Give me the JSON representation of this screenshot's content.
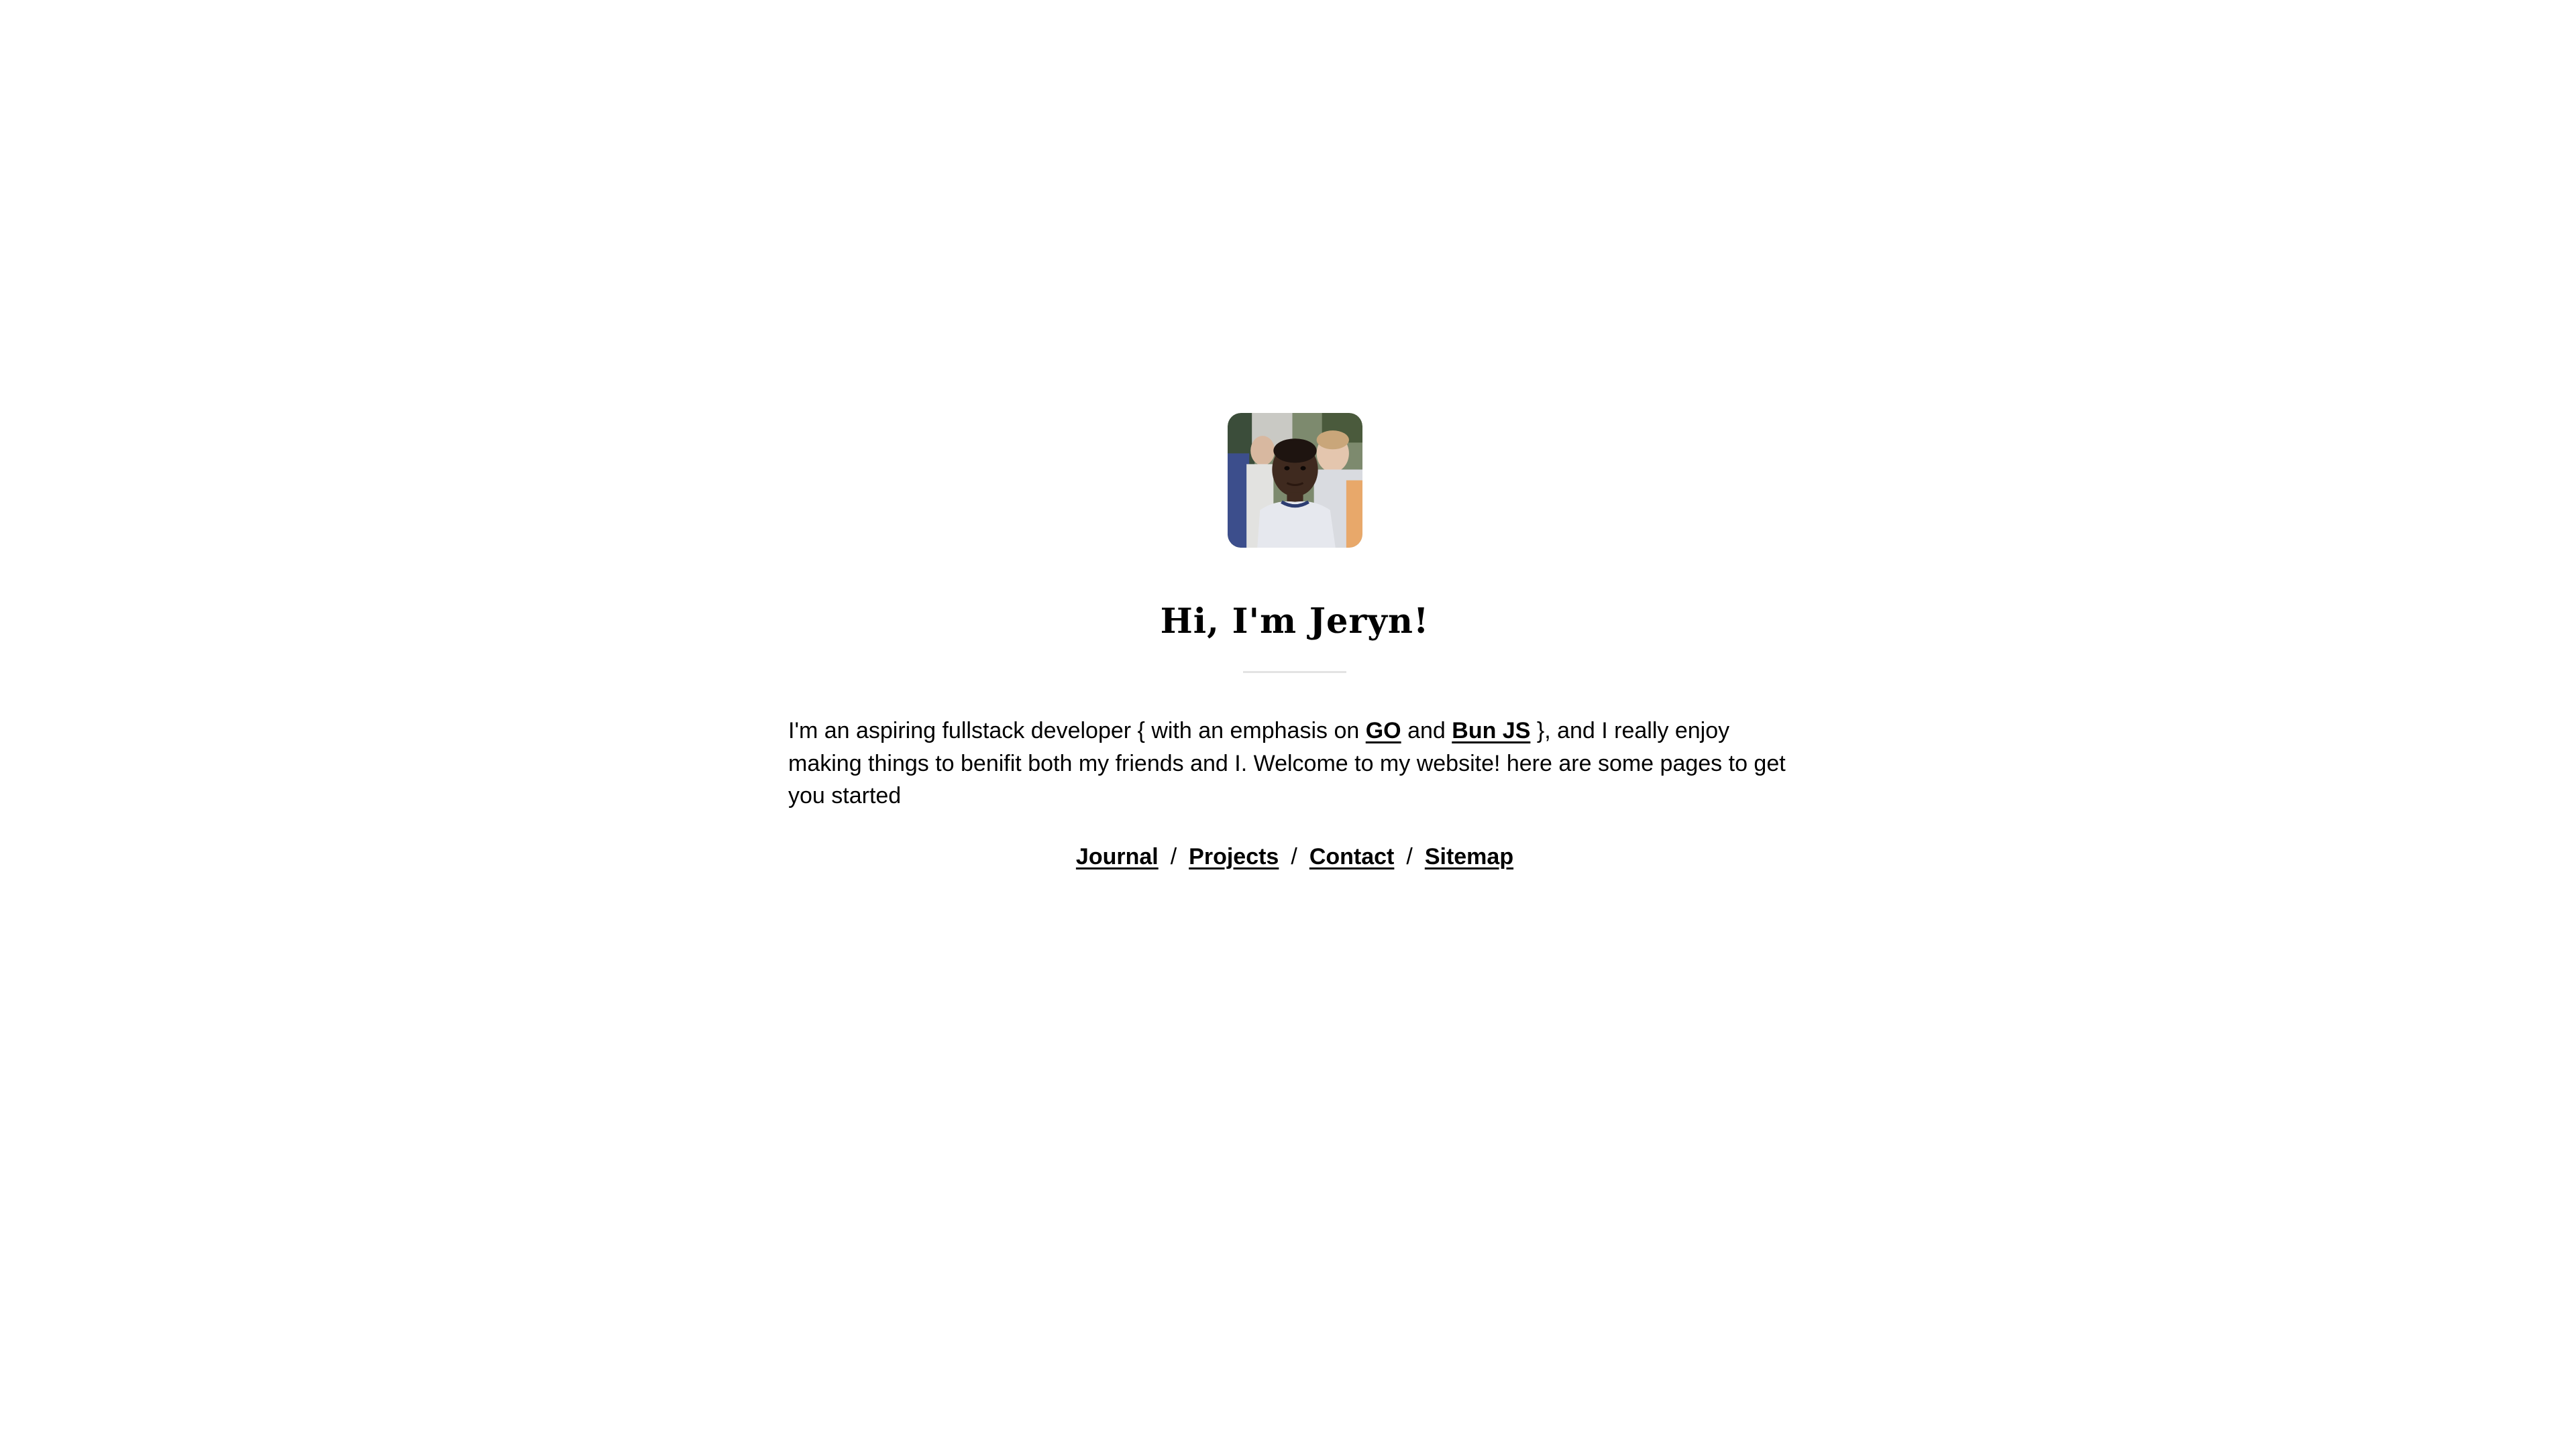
{
  "profile": {
    "avatar_alt": "profile photo",
    "heading": "Hi, I'm Jeryn!"
  },
  "intro": {
    "part1": "I'm an aspiring fullstack developer { with an emphasis on ",
    "link_go": "GO",
    "part2": " and ",
    "link_bun": "Bun JS",
    "part3": " }, and I really enjoy making things to benifit both my friends and I. Welcome to my website! here are some pages to get you started"
  },
  "nav": {
    "links": [
      "Journal",
      "Projects",
      "Contact",
      "Sitemap"
    ],
    "separator": "/"
  },
  "colors": {
    "background": "#ffffff",
    "text": "#000000",
    "divider": "#e3e3e3"
  }
}
